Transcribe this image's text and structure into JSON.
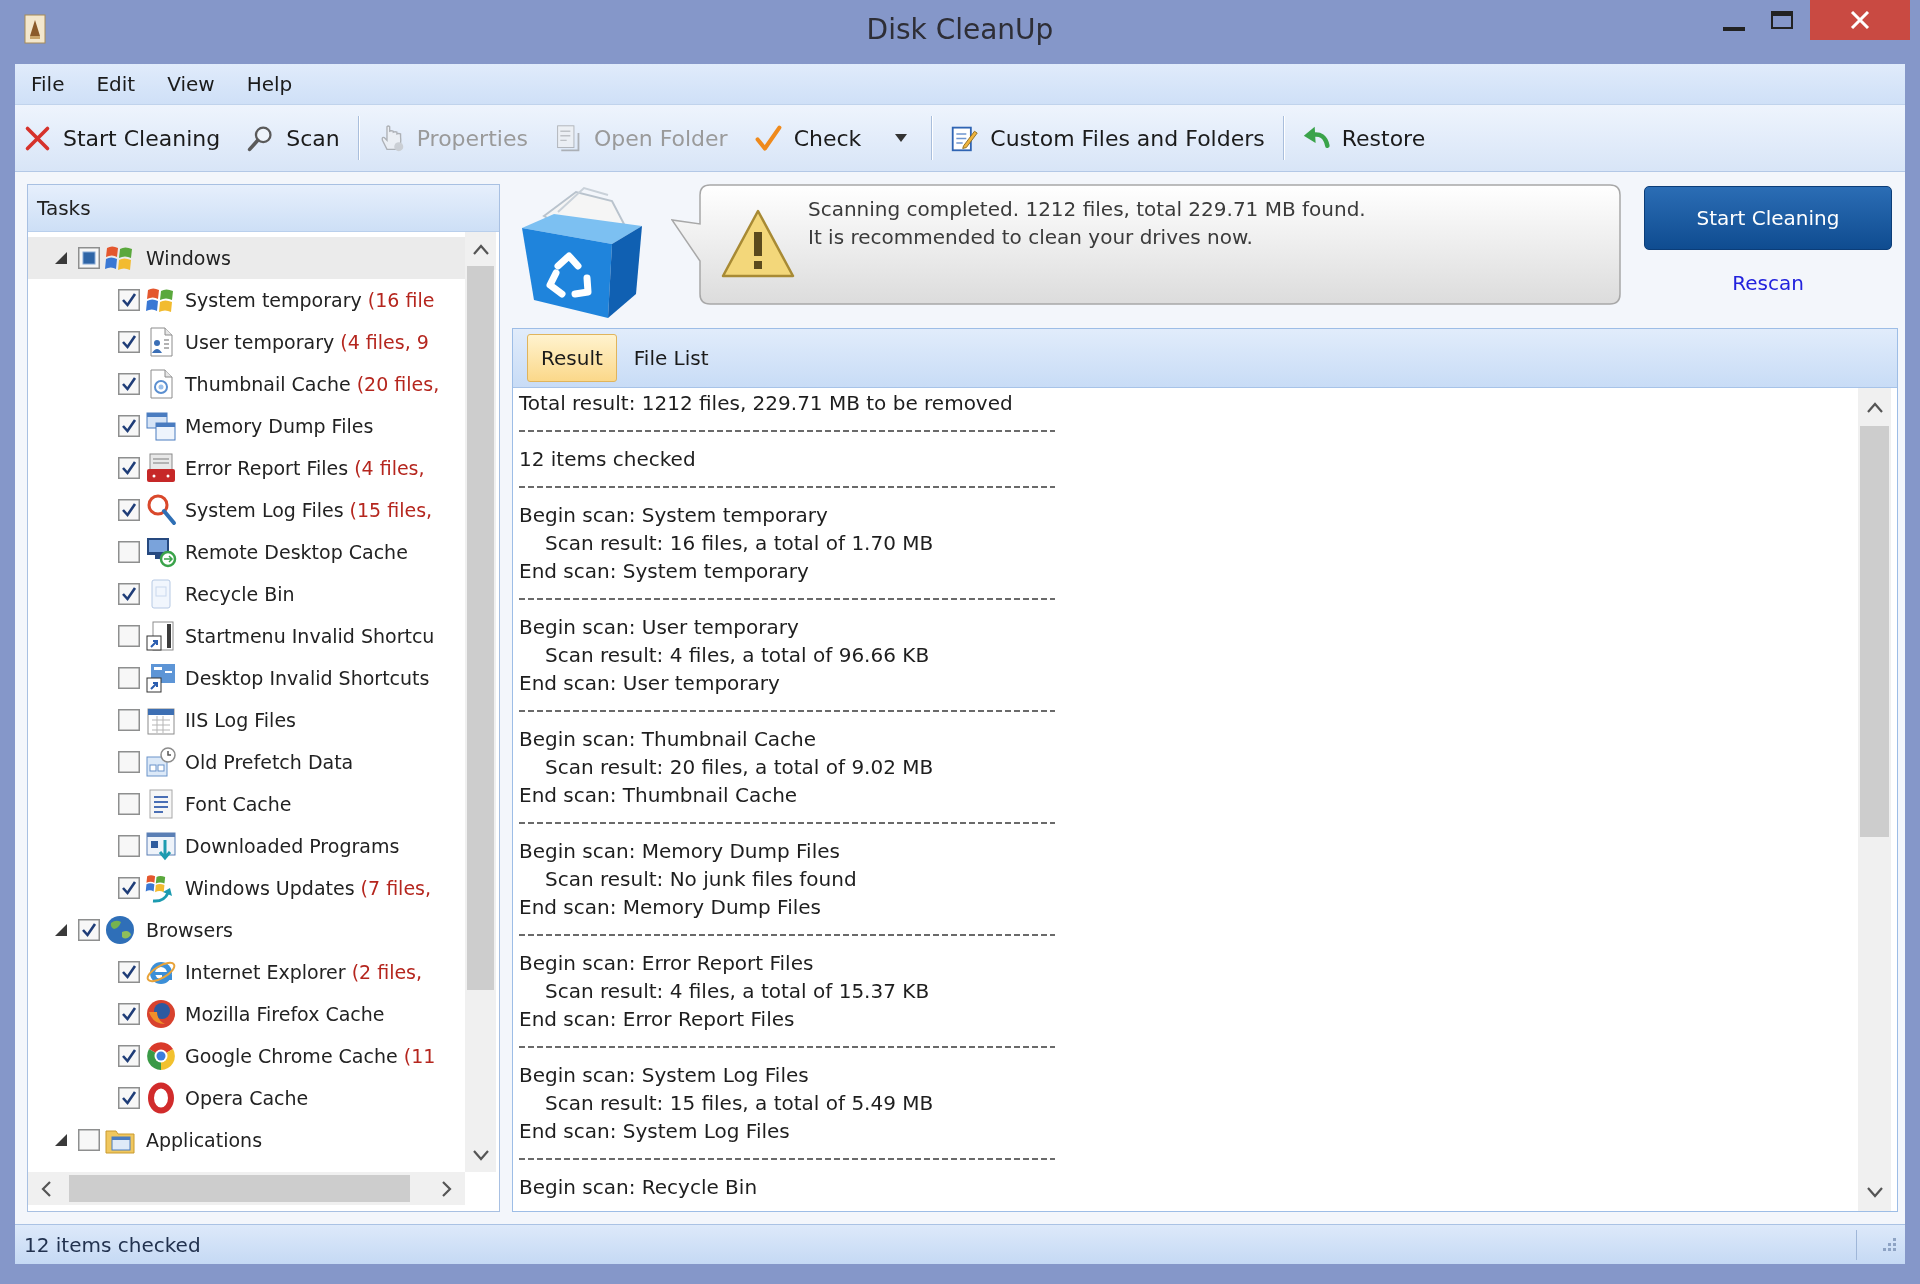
{
  "window": {
    "title": "Disk CleanUp"
  },
  "menu": [
    "File",
    "Edit",
    "View",
    "Help"
  ],
  "toolbar": {
    "groups": [
      [
        {
          "label": "Start Cleaning",
          "disabled": false,
          "menu": false
        },
        {
          "label": "Scan",
          "disabled": false,
          "menu": false
        }
      ],
      [
        {
          "label": "Properties",
          "disabled": true,
          "menu": false
        },
        {
          "label": "Open Folder",
          "disabled": true,
          "menu": false
        },
        {
          "label": "Check",
          "disabled": false,
          "menu": true
        }
      ],
      [
        {
          "label": "Custom Files and Folders",
          "disabled": false,
          "menu": false
        }
      ],
      [
        {
          "label": "Restore",
          "disabled": false,
          "menu": false
        }
      ]
    ]
  },
  "tasks": {
    "title": "Tasks",
    "groups": [
      {
        "label": "Windows",
        "expanded": true,
        "checked": false,
        "mixed": true,
        "selected": true,
        "children": [
          {
            "label": "System temporary",
            "detail": "(16 file",
            "checked": true,
            "selected": false
          },
          {
            "label": "User temporary",
            "detail": "(4 files, 9",
            "checked": true,
            "selected": false
          },
          {
            "label": "Thumbnail Cache",
            "detail": "(20 files,",
            "checked": true,
            "selected": false
          },
          {
            "label": "Memory Dump Files",
            "checked": true,
            "selected": false
          },
          {
            "label": "Error Report Files",
            "detail": "(4 files,",
            "checked": true,
            "selected": false
          },
          {
            "label": "System Log Files",
            "detail": "(15 files,",
            "checked": true,
            "selected": false
          },
          {
            "label": "Remote Desktop Cache",
            "checked": false,
            "selected": false
          },
          {
            "label": "Recycle Bin",
            "checked": true,
            "selected": false
          },
          {
            "label": "Startmenu Invalid Shortcu",
            "checked": false,
            "selected": false
          },
          {
            "label": "Desktop Invalid Shortcuts",
            "checked": false,
            "selected": false
          },
          {
            "label": "IIS Log Files",
            "checked": false,
            "selected": false
          },
          {
            "label": "Old Prefetch Data",
            "checked": false,
            "selected": false
          },
          {
            "label": "Font Cache",
            "checked": false,
            "selected": false
          },
          {
            "label": "Downloaded Programs",
            "checked": false,
            "selected": false
          },
          {
            "label": "Windows Updates",
            "detail": "(7 files,",
            "checked": true,
            "selected": false
          }
        ]
      },
      {
        "label": "Browsers",
        "expanded": true,
        "checked": true,
        "mixed": false,
        "selected": false,
        "children": [
          {
            "label": "Internet Explorer",
            "detail": "(2 files,",
            "checked": true,
            "selected": false
          },
          {
            "label": "Mozilla Firefox Cache",
            "checked": true,
            "selected": false
          },
          {
            "label": "Google Chrome Cache",
            "detail": "(11",
            "checked": true,
            "selected": false
          },
          {
            "label": "Opera Cache",
            "checked": true,
            "selected": false
          }
        ]
      },
      {
        "label": "Applications",
        "expanded": true,
        "checked": false,
        "mixed": false,
        "selected": false
      }
    ]
  },
  "notice": {
    "lines": [
      "Scanning completed. 1212 files, total 229.71 MB found.",
      "It is recommended to clean your drives now."
    ]
  },
  "actions": {
    "start_button": "Start Cleaning",
    "rescan_link": "Rescan"
  },
  "results": {
    "tabs": [
      {
        "label": "Result",
        "selected": true
      },
      {
        "label": "File List",
        "selected": false
      }
    ],
    "lines": [
      {
        "kind": "text",
        "text": "Total result: 1212 files, 229.71 MB to be removed"
      },
      {
        "kind": "divider"
      },
      {
        "kind": "text",
        "text": "12 items checked"
      },
      {
        "kind": "divider"
      },
      {
        "kind": "text",
        "text": "Begin scan: System temporary"
      },
      {
        "kind": "detail",
        "text": "Scan result: 16 files, a total of 1.70 MB"
      },
      {
        "kind": "text",
        "text": "End scan: System temporary"
      },
      {
        "kind": "divider"
      },
      {
        "kind": "text",
        "text": "Begin scan: User temporary"
      },
      {
        "kind": "detail",
        "text": "Scan result: 4 files, a total of 96.66 KB"
      },
      {
        "kind": "text",
        "text": "End scan: User temporary"
      },
      {
        "kind": "divider"
      },
      {
        "kind": "text",
        "text": "Begin scan: Thumbnail Cache"
      },
      {
        "kind": "detail",
        "text": "Scan result: 20 files, a total of 9.02 MB"
      },
      {
        "kind": "text",
        "text": "End scan: Thumbnail Cache"
      },
      {
        "kind": "divider"
      },
      {
        "kind": "text",
        "text": "Begin scan: Memory Dump Files"
      },
      {
        "kind": "detail",
        "text": "Scan result: No junk files found"
      },
      {
        "kind": "text",
        "text": "End scan: Memory Dump Files"
      },
      {
        "kind": "divider"
      },
      {
        "kind": "text",
        "text": "Begin scan: Error Report Files"
      },
      {
        "kind": "detail",
        "text": "Scan result: 4 files, a total of 15.37 KB"
      },
      {
        "kind": "text",
        "text": "End scan: Error Report Files"
      },
      {
        "kind": "divider"
      },
      {
        "kind": "text",
        "text": "Begin scan: System Log Files"
      },
      {
        "kind": "detail",
        "text": "Scan result: 15 files, a total of 5.49 MB"
      },
      {
        "kind": "text",
        "text": "End scan: System Log Files"
      },
      {
        "kind": "divider"
      },
      {
        "kind": "text",
        "text": "Begin scan: Recycle Bin"
      }
    ]
  },
  "status_bar": {
    "text": "12 items checked"
  }
}
